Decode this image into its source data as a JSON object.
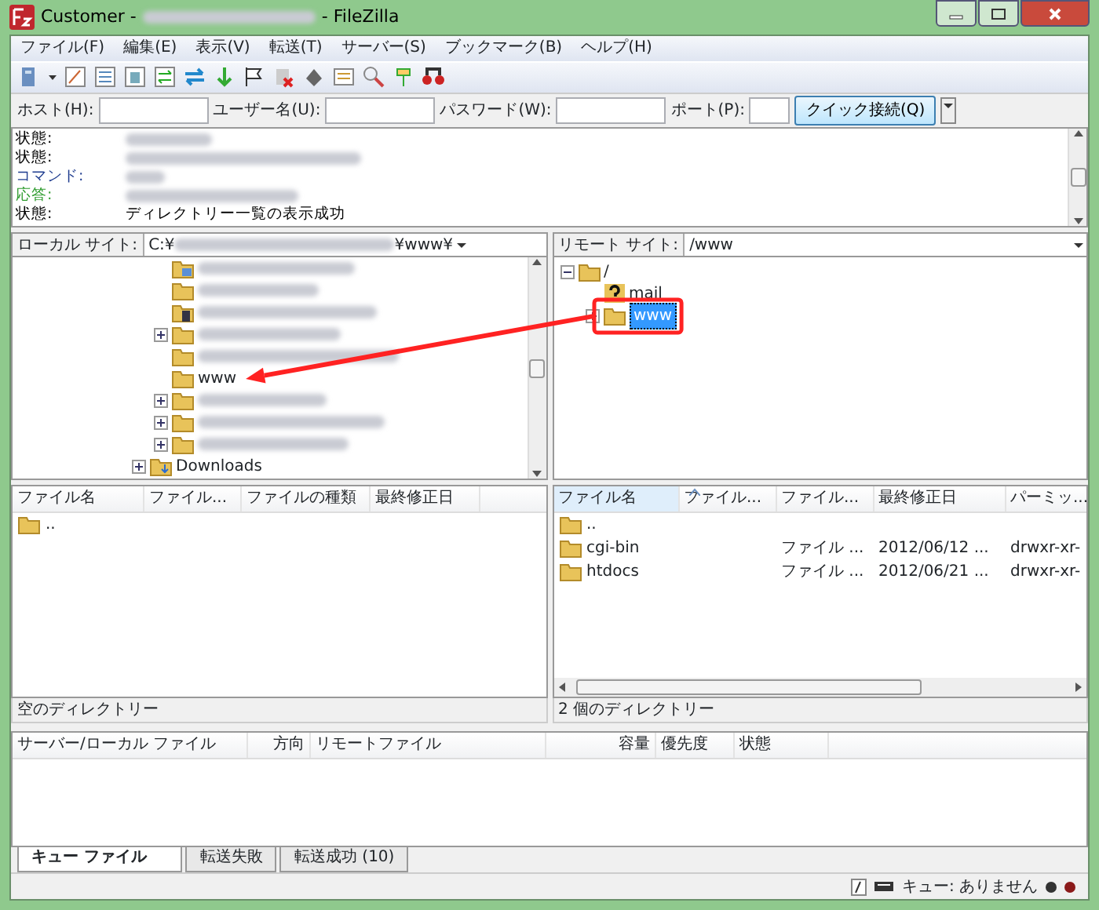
{
  "window": {
    "title_prefix": "Customer -",
    "title_suffix": "- FileZilla"
  },
  "menu": [
    "ファイル(F)",
    "編集(E)",
    "表示(V)",
    "転送(T)",
    "サーバー(S)",
    "ブックマーク(B)",
    "ヘルプ(H)"
  ],
  "quickconnect": {
    "host_label": "ホスト(H):",
    "user_label": "ユーザー名(U):",
    "password_label": "パスワード(W):",
    "port_label": "ポート(P):",
    "button": "クイック接続(Q)"
  },
  "log": [
    {
      "kind": "status",
      "label": "状態:",
      "blurred": true
    },
    {
      "kind": "status",
      "label": "状態:",
      "blurred": true
    },
    {
      "kind": "command",
      "label": "コマンド:",
      "blurred": true
    },
    {
      "kind": "response",
      "label": "応答:",
      "blurred": true
    },
    {
      "kind": "status",
      "label": "状態:",
      "blurred": false,
      "message": "ディレクトリー一覧の表示成功"
    }
  ],
  "local_site": {
    "label": "ローカル サイト:",
    "path_start": "C:¥",
    "path_end": "¥www¥"
  },
  "remote_site": {
    "label": "リモート サイト:",
    "path": "/www"
  },
  "local_tree": {
    "items": [
      {
        "kind": "pictures",
        "expandable": false,
        "blurred": true
      },
      {
        "kind": "folder",
        "expandable": false,
        "blurred": true
      },
      {
        "kind": "videos",
        "expandable": false,
        "blurred": true
      },
      {
        "kind": "folder",
        "expandable": true,
        "blurred": true
      },
      {
        "kind": "folder",
        "expandable": false,
        "blurred": true
      },
      {
        "kind": "folder",
        "expandable": false,
        "blurred": false,
        "label": "www"
      },
      {
        "kind": "folder",
        "expandable": true,
        "blurred": true
      },
      {
        "kind": "folder",
        "expandable": true,
        "blurred": true
      },
      {
        "kind": "folder",
        "expandable": true,
        "blurred": true
      }
    ],
    "parent_items": [
      {
        "kind": "downloads",
        "expandable": true,
        "blurred": false,
        "label": "Downloads"
      }
    ]
  },
  "remote_tree": [
    {
      "label": "/",
      "kind": "folder",
      "expandable": true,
      "expanded": true,
      "selected": false,
      "children": [
        {
          "label": "mail",
          "kind": "unknown",
          "expandable": false,
          "selected": false
        },
        {
          "label": "www",
          "kind": "folder",
          "expandable": true,
          "selected": true
        }
      ]
    }
  ],
  "local_files": {
    "columns": [
      {
        "label": "ファイル名",
        "sorted": false
      },
      {
        "label": "ファイル...",
        "sorted": false
      },
      {
        "label": "ファイルの種類",
        "sorted": false
      },
      {
        "label": "最終修正日",
        "sorted": false
      }
    ],
    "rows": [
      {
        "cells": [
          ".."
        ]
      }
    ],
    "status": "空のディレクトリー"
  },
  "remote_files": {
    "columns": [
      {
        "label": "ファイル名",
        "sorted": true
      },
      {
        "label": "ファイル...",
        "sorted": false
      },
      {
        "label": "ファイル...",
        "sorted": false
      },
      {
        "label": "最終修正日",
        "sorted": false
      },
      {
        "label": "パーミッ...",
        "sorted": false
      }
    ],
    "rows": [
      {
        "cells": [
          "..",
          "",
          "",
          "",
          ""
        ]
      },
      {
        "cells": [
          "cgi-bin",
          "",
          "ファイル ...",
          "2012/06/12 ...",
          "drwxr-xr-"
        ]
      },
      {
        "cells": [
          "htdocs",
          "",
          "ファイル ...",
          "2012/06/21 ...",
          "drwxr-xr-"
        ]
      }
    ],
    "status": "2 個のディレクトリー"
  },
  "queue": {
    "columns": [
      "サーバー/ローカル ファイル",
      "方向",
      "リモートファイル",
      "容量",
      "優先度",
      "状態"
    ],
    "tabs": [
      {
        "label": "キュー ファイル",
        "selected": true
      },
      {
        "label": "転送失敗",
        "selected": false
      },
      {
        "label": "転送成功 (10)",
        "selected": false
      }
    ]
  },
  "status_bar": {
    "queue": "キュー: ありません"
  }
}
